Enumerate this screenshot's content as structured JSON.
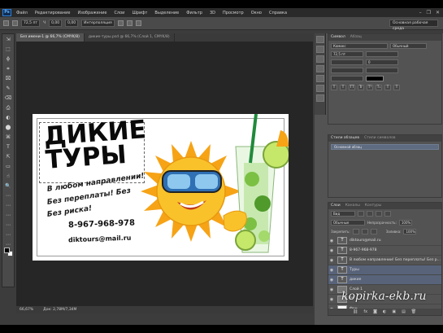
{
  "menu": {
    "logo": "Ps",
    "items": [
      "Файл",
      "Редактирование",
      "Изображение",
      "Слои",
      "Шрифт",
      "Выделение",
      "Фильтр",
      "3D",
      "Просмотр",
      "Окно",
      "Справка"
    ]
  },
  "window_controls": [
    "–",
    "❐",
    "✕"
  ],
  "options_bar": {
    "values": [
      "72,5 пт",
      "Ч",
      "0,00",
      "0,00",
      "Интерполяция"
    ],
    "workspace": "Основная рабочая среда"
  },
  "tools": [
    "⇲",
    "⬚",
    "ϕ",
    "⌗",
    "⌧",
    "✎",
    "⌫",
    "⎙",
    "◐",
    "⬤",
    "⌘",
    "T",
    "⇱",
    "▭",
    "☝",
    "🔍",
    "⋯",
    "⋯",
    "⋯",
    "⋯",
    "⋯",
    "⋯"
  ],
  "document": {
    "tabs": [
      "Без имени-1 @ 66,7% (CMYK/8)",
      "дикие-туры.psd @ 66,7% (Слой 1, CMYK/8)"
    ],
    "status_zoom": "66,67%",
    "status_doc": "Док: 2,78M/7,34M"
  },
  "canvas": {
    "title_line1": "ДИКИЕ",
    "title_line2": "ТУРЫ",
    "slogan1": "В любом направлении!",
    "slogan2": "Без переплаты! Без",
    "slogan3": "Без риска!",
    "phone": "8-967-968-978",
    "email": "diktours@mail.ru"
  },
  "character_panel": {
    "tabs": [
      "Символ",
      "Абзац"
    ],
    "font_family": "Комикс",
    "font_style": "Обычный",
    "size": "72,5 пт",
    "tracking": "0",
    "text_color": "#000000",
    "style_buttons": [
      "T",
      "T",
      "TT",
      "Tr",
      "T¹",
      "T₁",
      "T",
      "T"
    ]
  },
  "para_styles_panel": {
    "tabs": [
      "Стили абзацев",
      "Стили символов"
    ],
    "item": "Основной абзац"
  },
  "layers_panel": {
    "tabs": [
      "Слои",
      "Каналы",
      "Контуры"
    ],
    "filter": "Вид",
    "blend_mode": "Обычные",
    "opacity_label": "Непрозрачность:",
    "opacity": "100%",
    "lock_label": "Закрепить:",
    "fill_label": "Заливка:",
    "fill": "100%",
    "layers": [
      {
        "name": "diktours@mail.ru",
        "kind": "text",
        "selected": false
      },
      {
        "name": "8-967-968-978",
        "kind": "text",
        "selected": false
      },
      {
        "name": "В любом направлении! Без переплаты! Без р...",
        "kind": "text",
        "selected": false
      },
      {
        "name": "Туры",
        "kind": "text",
        "selected": true
      },
      {
        "name": "дикие",
        "kind": "text",
        "selected": true
      },
      {
        "name": "Слой 1",
        "kind": "image",
        "selected": false
      },
      {
        "name": "PY",
        "kind": "image",
        "selected": false
      },
      {
        "name": "Фон",
        "kind": "white",
        "selected": false
      }
    ],
    "footer_icons": [
      "⛓",
      "fx",
      "◙",
      "◐",
      "▣",
      "▤",
      "🗑"
    ]
  },
  "watermark": "kopirka-ekb.ru",
  "colors": {
    "accent_selection": "#58637a",
    "panel_bg": "#535353",
    "sun": "#f7b21c"
  }
}
